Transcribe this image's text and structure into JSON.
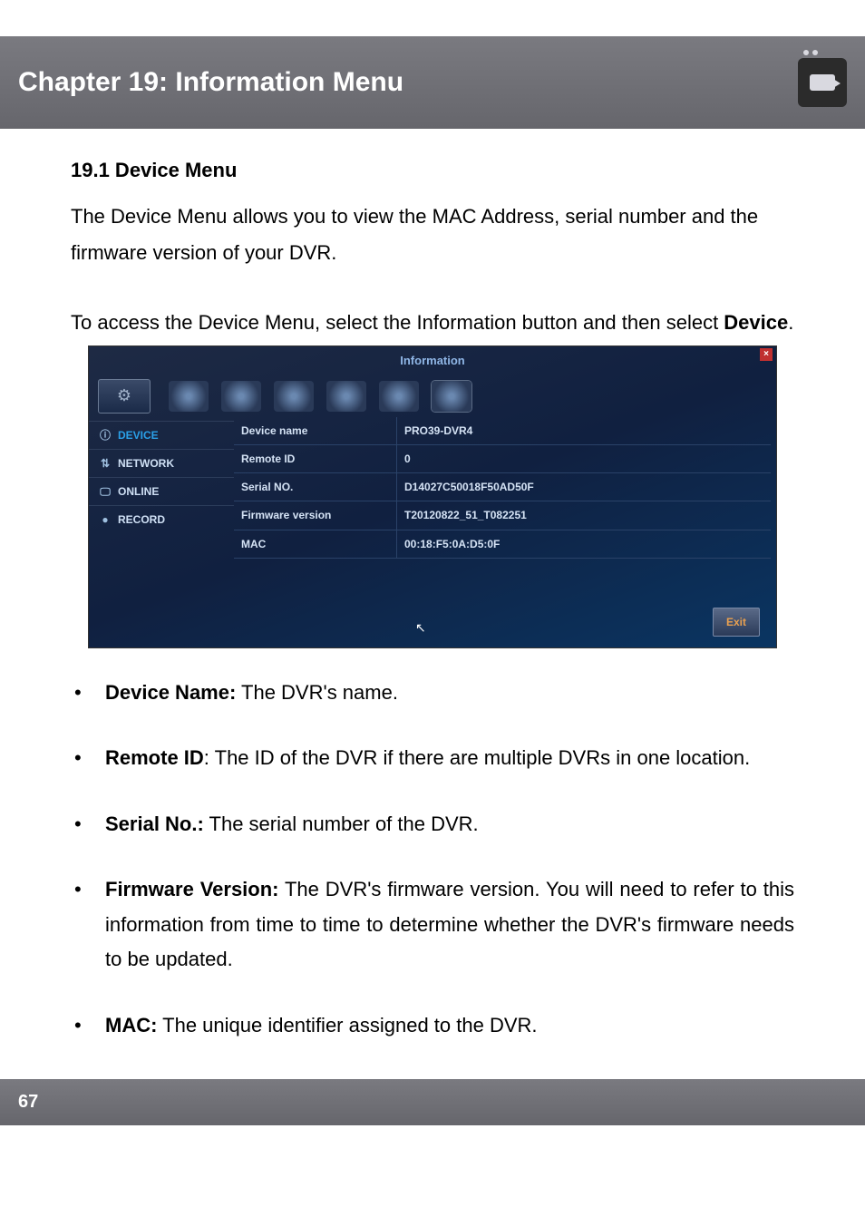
{
  "header": {
    "title": "Chapter 19: Information Menu"
  },
  "section_heading": "19.1 Device Menu",
  "intro_para": "The Device Menu allows you to view the MAC Address, serial number and the firmware version of your DVR.",
  "access_para_pre": "To access the Device Menu, select the Information button and then select ",
  "access_para_bold": "Device",
  "access_para_post": ".",
  "screenshot": {
    "window_title": "Information",
    "sidebar": {
      "items": [
        {
          "label": "DEVICE",
          "icon": "ⓘ",
          "active": true
        },
        {
          "label": "NETWORK",
          "icon": "⇅",
          "active": false
        },
        {
          "label": "ONLINE",
          "icon": "🖵",
          "active": false
        },
        {
          "label": "RECORD",
          "icon": "●",
          "active": false
        }
      ]
    },
    "rows": [
      {
        "k": "Device name",
        "v": "PRO39-DVR4"
      },
      {
        "k": "Remote ID",
        "v": "0"
      },
      {
        "k": "Serial NO.",
        "v": "D14027C50018F50AD50F"
      },
      {
        "k": "Firmware version",
        "v": "T20120822_51_T082251"
      },
      {
        "k": "MAC",
        "v": "00:18:F5:0A:D5:0F"
      }
    ],
    "exit_label": "Exit"
  },
  "bullets": [
    {
      "bold": "Device Name:",
      "rest": " The DVR's name."
    },
    {
      "bold": "Remote ID",
      "rest": ": The ID of the DVR if there are multiple DVRs in one location."
    },
    {
      "bold": "Serial No.:",
      "rest": " The serial number of the DVR."
    },
    {
      "bold": "Firmware Version:",
      "rest": " The DVR's firmware version. You will need to refer to this information from time to time to determine whether the DVR's firmware needs to be updated."
    },
    {
      "bold": "MAC:",
      "rest": " The unique identifier assigned to the DVR."
    }
  ],
  "page_number": "67"
}
